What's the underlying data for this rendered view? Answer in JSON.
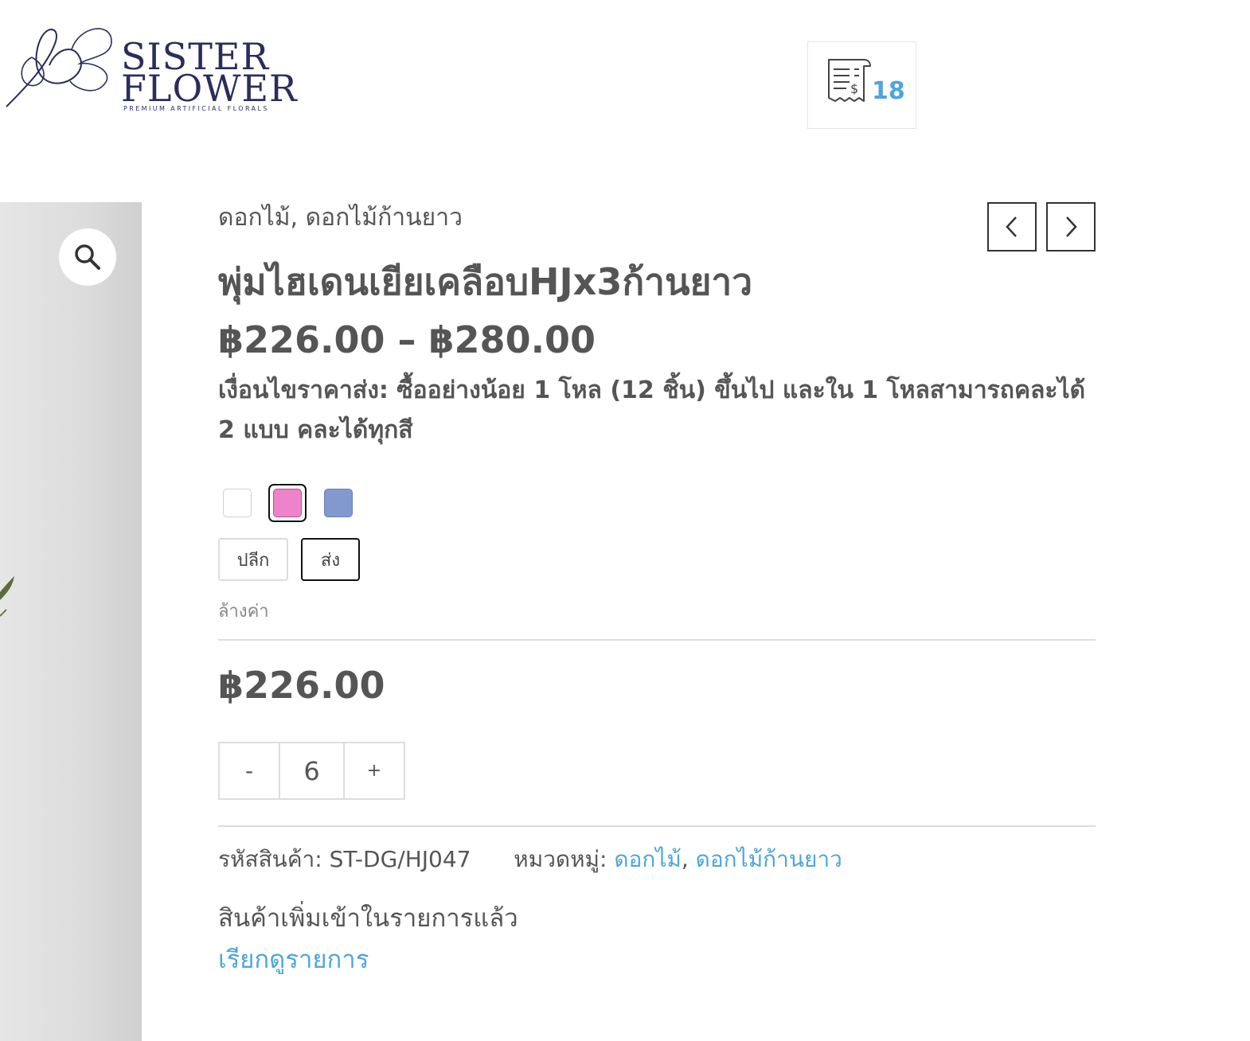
{
  "header": {
    "logo": {
      "name_line1": "SISTER",
      "name_line2": "FLOWER",
      "tagline": "PREMIUM ARTIFICIAL FLORALS"
    },
    "quote_list": {
      "icon": "receipt-dollar-icon",
      "count": "18"
    }
  },
  "gallery": {
    "zoom_icon": "magnifier-icon"
  },
  "product": {
    "categories_top": "ดอกไม้, ดอกไม้ก้านยาว",
    "title": "พุ่มไฮเดนเยียเคลือบHJx3ก้านยาว",
    "price_range": "฿226.00 – ฿280.00",
    "wholesale_note": "เงื่อนไขราคาส่ง: ซื้ออย่างน้อย 1 โหล (12 ชิ้น) ขึ้นไป และใน 1 โหลสามารถคละได้ 2 แบบ คละได้ทุกสี",
    "color_swatches": [
      {
        "color": "#ffffff",
        "selected": false
      },
      {
        "color": "#ef83cb",
        "selected": true
      },
      {
        "color": "#8299d0",
        "selected": false
      }
    ],
    "options": {
      "retail": "ปลีก",
      "wholesale": "ส่ง",
      "selected": "ส่ง"
    },
    "reset_label": "ล้างค่า",
    "price": "฿226.00",
    "quantity": {
      "minus": "-",
      "value": "6",
      "plus": "+"
    },
    "meta": {
      "sku_label": "รหัสสินค้า:",
      "sku": "ST-DG/HJ047",
      "category_label": "หมวดหมู่:",
      "category_1": "ดอกไม้",
      "separator": ",",
      "category_2": "ดอกไม้ก้านยาว"
    },
    "added_message": "สินค้าเพิ่มเข้าในรายการแล้ว",
    "view_list": "เรียกดูรายการ"
  },
  "colors": {
    "accent": "#4ea6dc",
    "text": "#555555",
    "logo": "#2a2d5c"
  }
}
